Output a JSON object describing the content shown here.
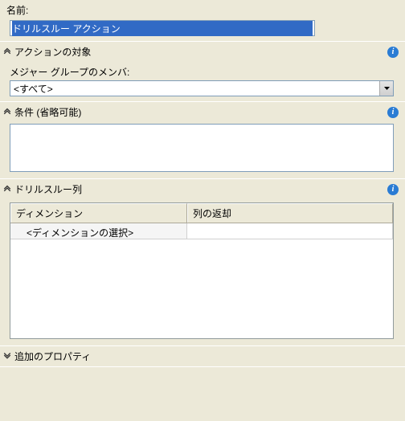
{
  "name_section": {
    "label": "名前:",
    "value": "ドリルスルー アクション"
  },
  "target_section": {
    "title": "アクションの対象",
    "member_label": "メジャー グループのメンバ:",
    "selected": "<すべて>"
  },
  "condition_section": {
    "title": "条件 (省略可能)",
    "value": ""
  },
  "columns_section": {
    "title": "ドリルスルー列",
    "headers": {
      "dimension": "ディメンション",
      "return": "列の返却"
    },
    "row_placeholder": "<ディメンションの選択>"
  },
  "extra_section": {
    "title": "追加のプロパティ"
  },
  "icons": {
    "info": "i"
  },
  "glyphs": {
    "expand": "«",
    "collapse": "»"
  }
}
